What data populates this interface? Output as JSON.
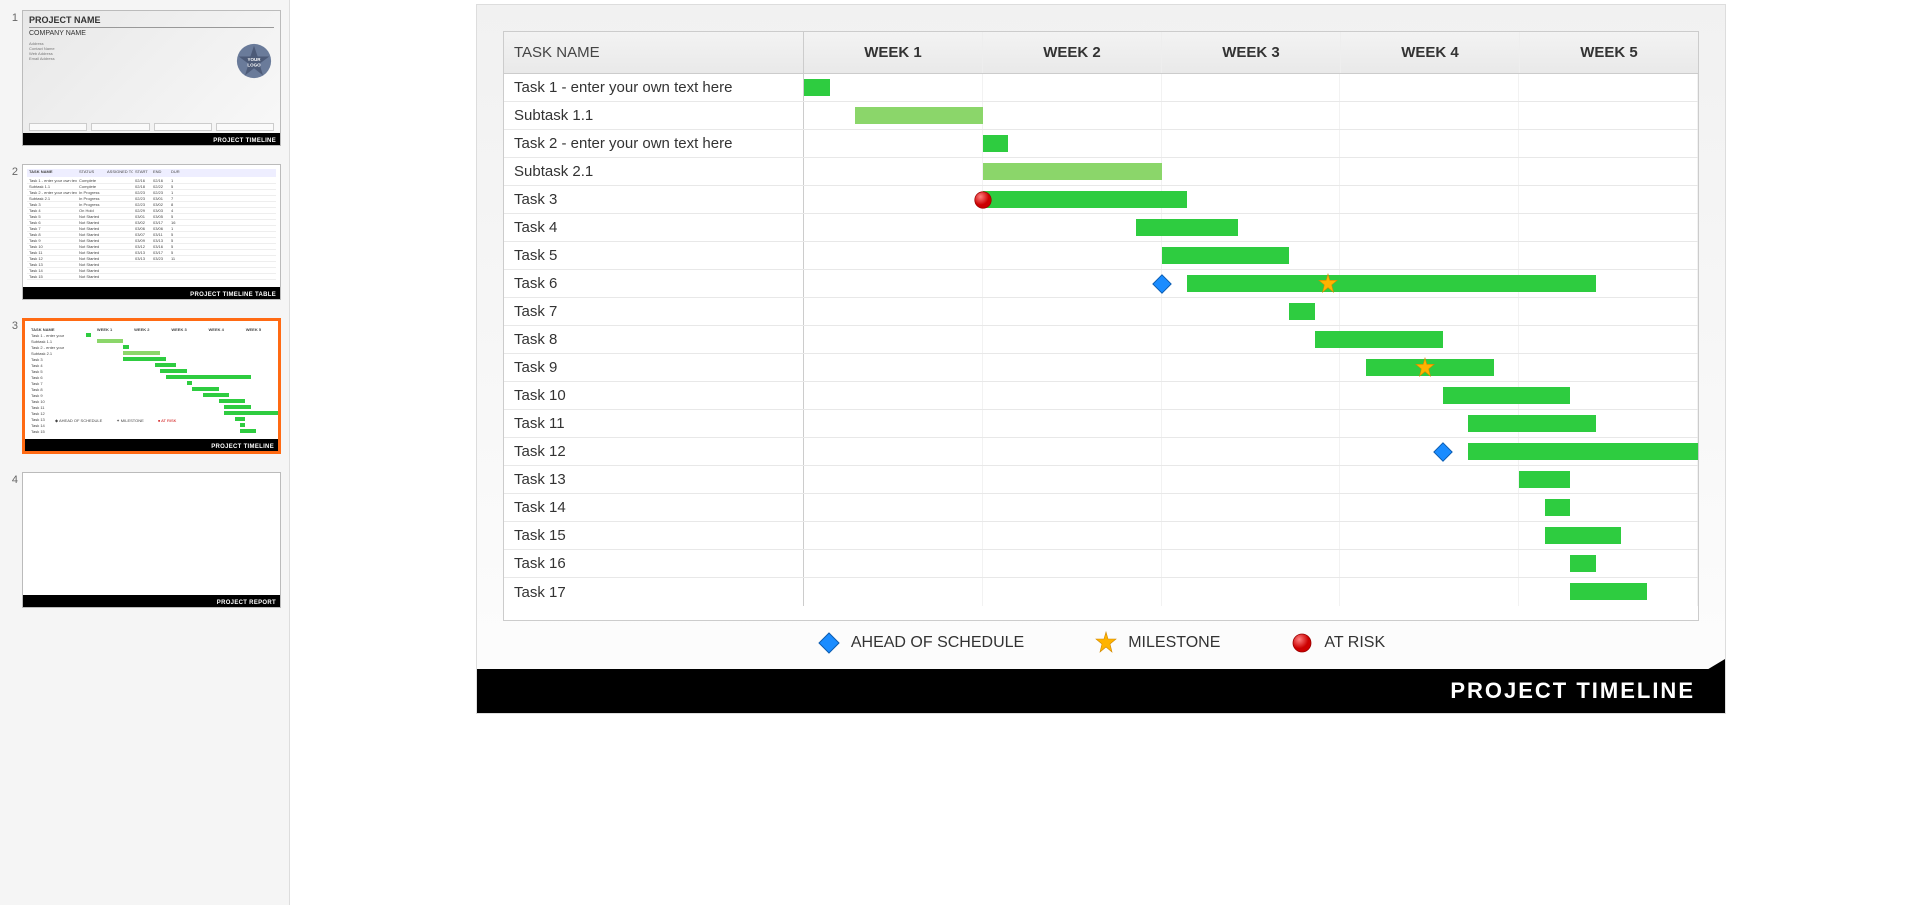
{
  "sidebar": {
    "slides": [
      {
        "num": "1",
        "footer": "PROJECT TIMELINE",
        "title": "PROJECT NAME",
        "subtitle": "COMPANY NAME",
        "logo_text": "YOUR LOGO"
      },
      {
        "num": "2",
        "footer": "PROJECT TIMELINE TABLE"
      },
      {
        "num": "3",
        "footer": "PROJECT TIMELINE"
      },
      {
        "num": "4",
        "footer": "PROJECT REPORT"
      }
    ]
  },
  "chart_data": {
    "type": "gantt",
    "title": "PROJECT TIMELINE",
    "task_header": "TASK NAME",
    "weeks": [
      "WEEK 1",
      "WEEK 2",
      "WEEK 3",
      "WEEK 4",
      "WEEK 5"
    ],
    "day_span": 35,
    "tasks": [
      {
        "name": "Task 1 - enter your own text here",
        "start": 0,
        "len": 1,
        "light": false,
        "markers": []
      },
      {
        "name": "Subtask 1.1",
        "start": 2,
        "len": 5,
        "light": true,
        "markers": []
      },
      {
        "name": "Task 2 - enter your own text here",
        "start": 7,
        "len": 1,
        "light": false,
        "markers": []
      },
      {
        "name": "Subtask 2.1",
        "start": 7,
        "len": 7,
        "light": true,
        "markers": []
      },
      {
        "name": "Task 3",
        "start": 7,
        "len": 8,
        "light": false,
        "markers": [
          {
            "type": "risk",
            "at": 7
          }
        ]
      },
      {
        "name": "Task 4",
        "start": 13,
        "len": 4,
        "light": false,
        "markers": []
      },
      {
        "name": "Task 5",
        "start": 14,
        "len": 5,
        "light": false,
        "markers": []
      },
      {
        "name": "Task 6",
        "start": 15,
        "len": 16,
        "light": false,
        "markers": [
          {
            "type": "ahead",
            "at": 14
          },
          {
            "type": "milestone",
            "at": 20.5
          }
        ]
      },
      {
        "name": "Task 7",
        "start": 19,
        "len": 1,
        "light": false,
        "markers": []
      },
      {
        "name": "Task 8",
        "start": 20,
        "len": 5,
        "light": false,
        "markers": []
      },
      {
        "name": "Task 9",
        "start": 22,
        "len": 5,
        "light": false,
        "markers": [
          {
            "type": "milestone",
            "at": 24.3
          }
        ]
      },
      {
        "name": "Task 10",
        "start": 25,
        "len": 5,
        "light": false,
        "markers": []
      },
      {
        "name": "Task 11",
        "start": 26,
        "len": 5,
        "light": false,
        "markers": []
      },
      {
        "name": "Task 12",
        "start": 26,
        "len": 11,
        "light": false,
        "markers": [
          {
            "type": "ahead",
            "at": 25
          }
        ]
      },
      {
        "name": "Task 13",
        "start": 28,
        "len": 2,
        "light": false,
        "markers": []
      },
      {
        "name": "Task 14",
        "start": 29,
        "len": 1,
        "light": false,
        "markers": []
      },
      {
        "name": "Task 15",
        "start": 29,
        "len": 3,
        "light": false,
        "markers": []
      },
      {
        "name": "Task 16",
        "start": 30,
        "len": 1,
        "light": false,
        "markers": []
      },
      {
        "name": "Task 17",
        "start": 30,
        "len": 3,
        "light": false,
        "markers": []
      }
    ],
    "legend": [
      {
        "type": "ahead",
        "label": "AHEAD OF SCHEDULE"
      },
      {
        "type": "milestone",
        "label": "MILESTONE"
      },
      {
        "type": "risk",
        "label": "AT RISK"
      }
    ]
  }
}
